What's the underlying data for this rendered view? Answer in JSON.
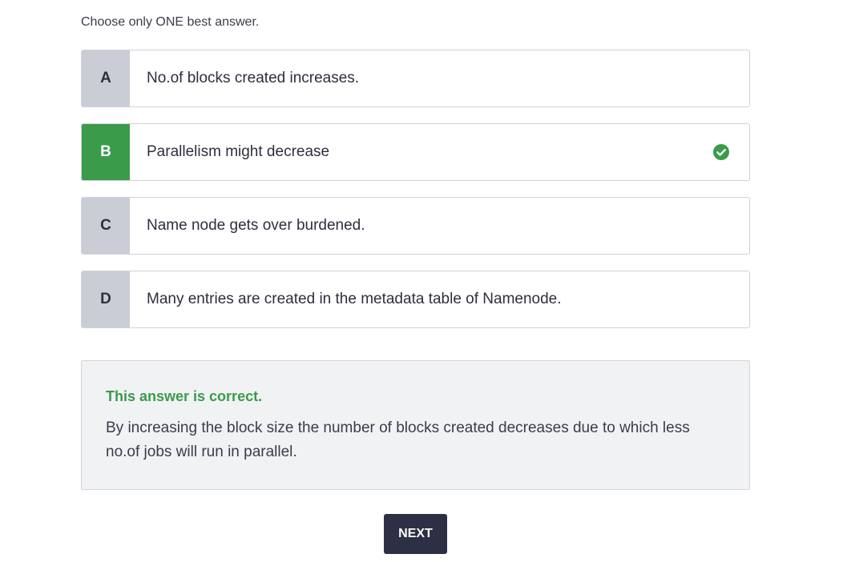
{
  "quiz": {
    "instruction": "Choose only ONE best answer.",
    "options": [
      {
        "letter": "A",
        "text": "No.of blocks created increases.",
        "state": "default"
      },
      {
        "letter": "B",
        "text": "Parallelism might decrease",
        "state": "correct",
        "icon": "check-circle-icon"
      },
      {
        "letter": "C",
        "text": "Name node gets over burdened.",
        "state": "default"
      },
      {
        "letter": "D",
        "text": "Many entries are created in the metadata table of Namenode.",
        "state": "default"
      }
    ],
    "feedback": {
      "status": "This answer is correct.",
      "explanation": "By increasing the block size the number of blocks created decreases due to which less no.of jobs will run in parallel."
    },
    "next_label": "NEXT"
  },
  "colors": {
    "correct": "#3a9b4b",
    "letter_bg": "#cbcdd6",
    "button_bg": "#2d2f45",
    "feedback_bg": "#f1f2f4"
  }
}
